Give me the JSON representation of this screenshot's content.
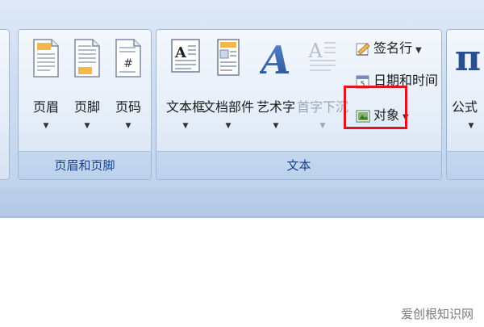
{
  "groups": {
    "header_footer": {
      "label": "页眉和页脚",
      "buttons": [
        {
          "label": "页眉",
          "icon": "header-page-icon"
        },
        {
          "label": "页脚",
          "icon": "footer-page-icon"
        },
        {
          "label": "页码",
          "icon": "page-number-icon"
        }
      ]
    },
    "text": {
      "label": "文本",
      "big_buttons": [
        {
          "label": "文本框",
          "icon": "textbox-icon"
        },
        {
          "label": "文档部件",
          "icon": "quick-parts-icon"
        },
        {
          "label": "艺术字",
          "icon": "wordart-icon"
        },
        {
          "label": "首字下沉",
          "icon": "drop-cap-icon",
          "state": "disabled"
        }
      ],
      "small_buttons": [
        {
          "label": "签名行",
          "icon": "signature-line-icon"
        },
        {
          "label": "日期和时间",
          "icon": "date-time-icon"
        },
        {
          "label": "对象",
          "icon": "object-icon"
        }
      ]
    },
    "symbols": {
      "buttons": [
        {
          "label": "公式",
          "icon": "equation-pi-icon"
        }
      ]
    }
  },
  "watermark": "爱创根知识网",
  "colors": {
    "highlight": "#e0141e",
    "group_label_text": "#15428b"
  }
}
